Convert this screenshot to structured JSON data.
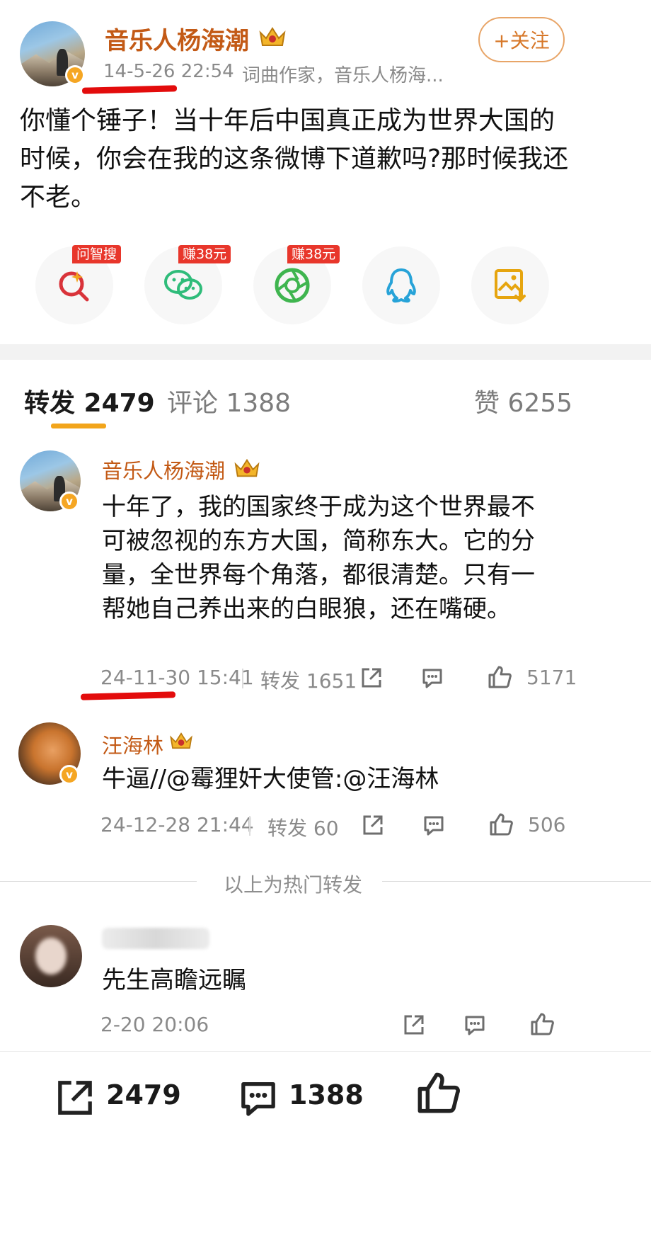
{
  "post": {
    "author": "音乐人杨海潮",
    "date": "14-5-26 22:54",
    "source": "词曲作家，音乐人杨海...",
    "follow_label": "+关注",
    "text": "你懂个锤子！当十年后中国真正成为世界大国的时候，你会在我的这条微博下道歉吗?那时候我还不老。"
  },
  "share_bar": {
    "items": [
      {
        "name": "search",
        "promo": "问智搜",
        "color": "#d9333a"
      },
      {
        "name": "wechat",
        "promo": "赚38元",
        "color": "#2fbc7a"
      },
      {
        "name": "moments",
        "promo": "赚38元",
        "color": "#3fb54f"
      },
      {
        "name": "qq",
        "promo": "",
        "color": "#27a3d8"
      },
      {
        "name": "save-image",
        "promo": "",
        "color": "#e6a50f"
      }
    ]
  },
  "tabs": {
    "repost": "转发 2479",
    "comment": "评论 1388",
    "like": "赞 6255"
  },
  "reposts": [
    {
      "author": "音乐人杨海潮",
      "text": "十年了，我的国家终于成为这个世界最不可被忽视的东方大国，简称东大。它的分量，全世界每个角落，都很清楚。只有一帮她自己养出来的白眼狼，还在嘴硬。",
      "date": "24-11-30 15:41",
      "repost_label": "转发 1651",
      "likes": "5171"
    },
    {
      "author": "汪海林",
      "text": "牛逼//@霉狸奸大使管:@汪海林",
      "date": "24-12-28 21:44",
      "repost_label": "转发 60",
      "likes": "506"
    }
  ],
  "hot_divider": "以上为热门转发",
  "latest": {
    "text": "先生高瞻远瞩",
    "date": "2-20 20:06"
  },
  "bottom_bar": {
    "reposts": "2479",
    "comments": "1388"
  },
  "colors": {
    "accent": "#f2a51b",
    "username": "#c35a16",
    "annotation": "#e30c0c"
  }
}
